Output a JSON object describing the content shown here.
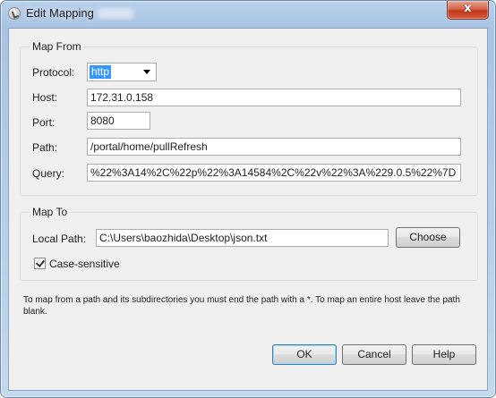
{
  "window": {
    "title": "Edit Mapping",
    "close_glyph": "x"
  },
  "map_from": {
    "group_label": "Map From",
    "protocol_label": "Protocol:",
    "protocol_value": "http",
    "host_label": "Host:",
    "host_value": "172.31.0.158",
    "port_label": "Port:",
    "port_value": "8080",
    "path_label": "Path:",
    "path_value": "/portal/home/pullRefresh",
    "query_label": "Query:",
    "query_value": "%22%3A14%2C%22p%22%3A14584%2C%22v%22%3A%229.0.5%22%7D"
  },
  "map_to": {
    "group_label": "Map To",
    "local_path_label": "Local Path:",
    "local_path_value": "C:\\Users\\baozhida\\Desktop\\json.txt",
    "choose_label": "Choose",
    "case_sensitive_label": "Case-sensitive",
    "case_sensitive_checked": true
  },
  "note": "To map from a path and its subdirectories you must end the path with a *. To map an entire host leave the path blank.",
  "buttons": {
    "ok": "OK",
    "cancel": "Cancel",
    "help": "Help"
  },
  "colors": {
    "selection": "#3399ff",
    "close_button": "#c2391d",
    "window_frame": "#b9d1ea",
    "dialog_bg": "#f0f0f0"
  },
  "icons": {
    "app": "app-icon",
    "close": "close-icon",
    "dropdown": "chevron-down-icon",
    "check": "check-icon"
  }
}
